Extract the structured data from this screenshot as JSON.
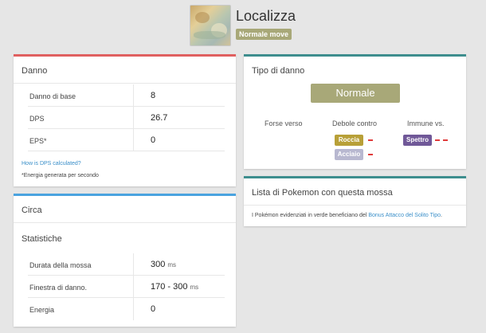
{
  "header": {
    "title": "Localizza",
    "badge": "Normale move"
  },
  "damage_card": {
    "title": "Danno",
    "rows": [
      {
        "label": "Danno di base",
        "value": "8"
      },
      {
        "label": "DPS",
        "value": "26.7"
      },
      {
        "label": "EPS*",
        "value": "0"
      }
    ],
    "link": "How is DPS calculated?",
    "footnote": "*Energia generata per secondo"
  },
  "about_card": {
    "title": "Circa",
    "subtitle": "Statistiche",
    "rows": [
      {
        "label": "Durata della mossa",
        "value": "300",
        "unit": "ms"
      },
      {
        "label": "Finestra di danno.",
        "value": "170 - 300",
        "unit": "ms"
      },
      {
        "label": "Energia",
        "value": "0",
        "unit": ""
      }
    ]
  },
  "type_card": {
    "title": "Tipo di danno",
    "type_name": "Normale",
    "columns": [
      "Forse verso",
      "Debole contro",
      "Immune vs."
    ],
    "weak_against": [
      "Roccia",
      "Acciaio"
    ],
    "immune_vs": [
      "Spettro"
    ],
    "colors": {
      "normale": "#a8a878",
      "roccia": "#b8a038",
      "acciaio": "#b8b8d0",
      "spettro": "#705898"
    }
  },
  "list_card": {
    "title": "Lista di Pokemon con questa mossa",
    "text_prefix": "I Pokémon evidenziati in verde beneficiano del",
    "text_link": "Bonus Attacco del Solito Tipo",
    "text_suffix": "."
  }
}
